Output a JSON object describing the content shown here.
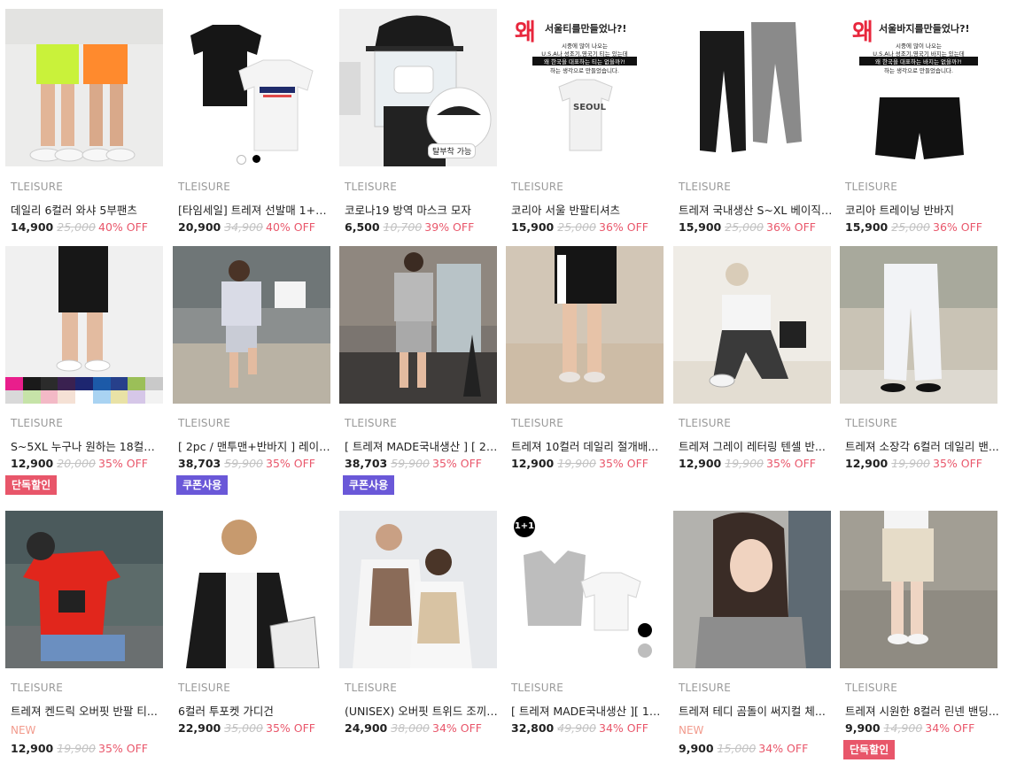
{
  "products": [
    {
      "brand": "TLEISURE",
      "name": "데일리 6컬러 와샤 5부팬츠",
      "price": "14,900",
      "original": "25,000",
      "discount": "40% OFF"
    },
    {
      "brand": "TLEISURE",
      "name": "[타임세일] 트레져 선발매 1+1 ...",
      "price": "20,900",
      "original": "34,900",
      "discount": "40% OFF"
    },
    {
      "brand": "TLEISURE",
      "name": "코로나19 방역 마스크 모자",
      "price": "6,500",
      "original": "10,700",
      "discount": "39% OFF",
      "image_text": "탈부착 가능"
    },
    {
      "brand": "TLEISURE",
      "name": "코리아 서울 반팔티셔츠",
      "price": "15,900",
      "original": "25,000",
      "discount": "36% OFF",
      "image_text": {
        "headline_big": "왜",
        "headline": "서울티를만들었나?!",
        "line1": "시중에 많이 나오는",
        "line2": "U.S.A나 성조기,영국기 티는 있는데",
        "line3": "왜 한국을 대표하는 티는 없을까?!",
        "line4": "하는 생각으로 만들었습니다.",
        "shirt_print": "SEOUL"
      }
    },
    {
      "brand": "TLEISURE",
      "name": "트레져 국내생산 S~XL 베이직 ...",
      "price": "15,900",
      "original": "25,000",
      "discount": "36% OFF"
    },
    {
      "brand": "TLEISURE",
      "name": "코리아 트레이닝 반바지",
      "price": "15,900",
      "original": "25,000",
      "discount": "36% OFF",
      "image_text": {
        "headline_big": "왜",
        "headline": "서울바지를만들었나?!",
        "line1": "시중에 많이 나오는",
        "line2": "U.S.A나 성조기,영국기 바지는 있는데",
        "line3": "왜 한국을 대표하는 바지는 없을까?!",
        "line4": "하는 생각으로 만들었습니다."
      }
    },
    {
      "brand": "TLEISURE",
      "name": "S~5XL 누구나 원하는 18컬러 ...",
      "price": "12,900",
      "original": "20,000",
      "discount": "35% OFF",
      "badge": "단독할인"
    },
    {
      "brand": "TLEISURE",
      "name": "[ 2pc / 맨투맨+반바지 ] 레이어...",
      "price": "38,703",
      "original": "59,900",
      "discount": "35% OFF",
      "badge": "쿠폰사용"
    },
    {
      "brand": "TLEISURE",
      "name": "[ 트레져 MADE국내생산 ] [ 2p...",
      "price": "38,703",
      "original": "59,900",
      "discount": "35% OFF",
      "badge": "쿠폰사용"
    },
    {
      "brand": "TLEISURE",
      "name": "트레져 10컬러 데일리 절개배...",
      "price": "12,900",
      "original": "19,900",
      "discount": "35% OFF"
    },
    {
      "brand": "TLEISURE",
      "name": "트레져 그레이 레터링 텐셀 반...",
      "price": "12,900",
      "original": "19,900",
      "discount": "35% OFF"
    },
    {
      "brand": "TLEISURE",
      "name": "트레져 소장각 6컬러 데일리 밴...",
      "price": "12,900",
      "original": "19,900",
      "discount": "35% OFF"
    },
    {
      "brand": "TLEISURE",
      "name": "트레져 켄드릭 오버핏 반팔 티...",
      "tag": "NEW",
      "price": "12,900",
      "original": "19,900",
      "discount": "35% OFF"
    },
    {
      "brand": "TLEISURE",
      "name": "6컬러 투포켓 가디건",
      "price": "22,900",
      "original": "35,000",
      "discount": "35% OFF"
    },
    {
      "brand": "TLEISURE",
      "name": "(UNISEX) 오버핏 트위드 조끼 ...",
      "price": "24,900",
      "original": "38,000",
      "discount": "34% OFF"
    },
    {
      "brand": "TLEISURE",
      "name": "[ 트레져 MADE국내생산 ][ 1+...",
      "price": "32,800",
      "original": "49,900",
      "discount": "34% OFF",
      "image_text": "1+1"
    },
    {
      "brand": "TLEISURE",
      "name": "트레져 테디 곰돌이 써지컬 체...",
      "tag": "NEW",
      "price": "9,900",
      "original": "15,000",
      "discount": "34% OFF"
    },
    {
      "brand": "TLEISURE",
      "name": "트레져 시원한 8컬러 린넨 밴딩...",
      "price": "9,900",
      "original": "14,900",
      "discount": "34% OFF",
      "badge": "단독할인"
    }
  ],
  "colors": {
    "discount": "#e9576b",
    "badge_exclusive": "#e8566a",
    "badge_coupon": "#6a58d8",
    "new_tag": "#f29b8d"
  }
}
